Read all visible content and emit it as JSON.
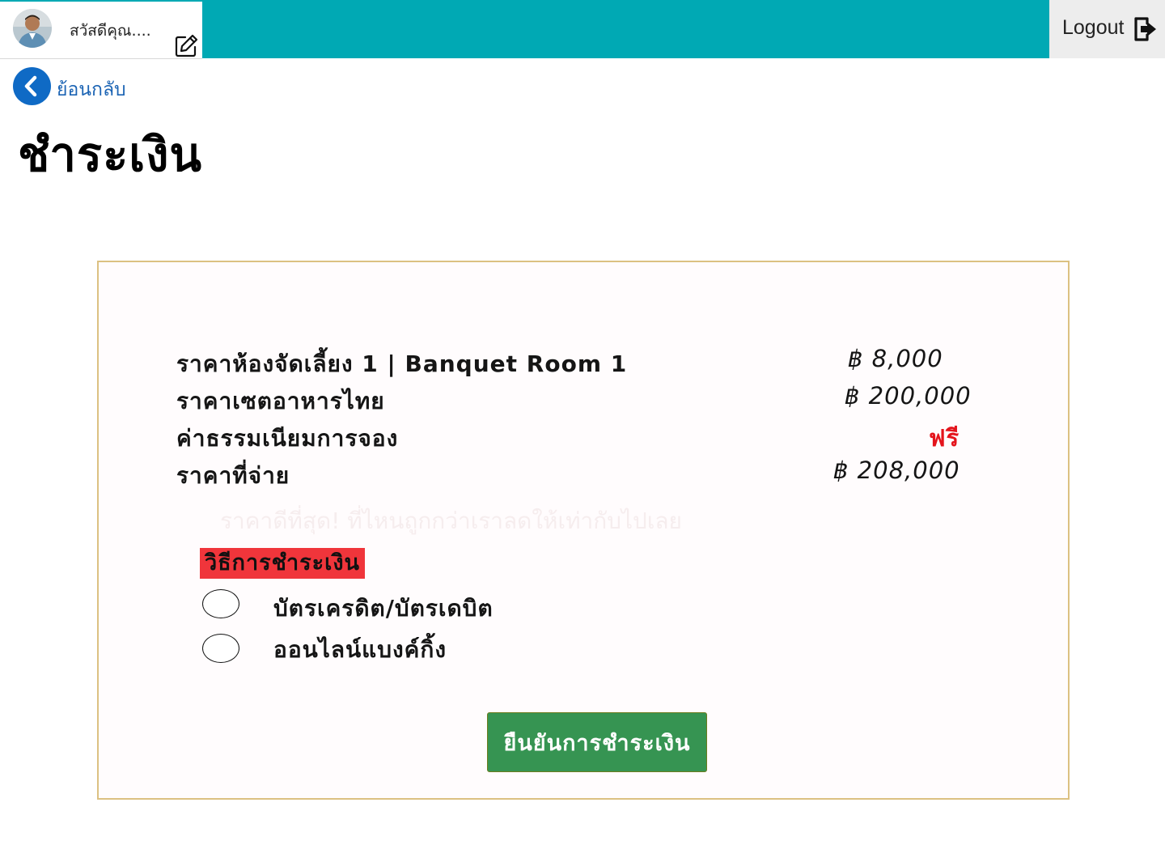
{
  "header": {
    "greeting": "สวัสดีคุณ....",
    "logout_label": "Logout",
    "accent_color": "#00a9b4",
    "icons": {
      "avatar": "user-photo",
      "edit": "edit-icon",
      "logout": "logout-icon"
    }
  },
  "nav": {
    "back_label": "ย้อนกลับ",
    "back_icon": "chevron-left-icon"
  },
  "page": {
    "title": "ชำระเงิน"
  },
  "summary": {
    "rows": [
      {
        "label": "ราคาห้องจัดเลี้ยง 1 | Banquet Room 1",
        "value": "฿  8,000"
      },
      {
        "label": "ราคาเซตอาหารไทย",
        "value": "฿ 200,000"
      },
      {
        "label": "ค่าธรรมเนียมการจอง",
        "value": "ฟรี"
      },
      {
        "label": "ราคาที่จ่าย",
        "value": "฿ 208,000"
      }
    ],
    "promo_text": "ราคาดีที่สุด! ที่ไหนถูกกว่าเราลดให้เท่ากับไปเลย"
  },
  "payment": {
    "heading": "วิธีการชำระเงิน",
    "options": [
      {
        "label": "บัตรเครดิต/บัตรเดบิต"
      },
      {
        "label": "ออนไลน์แบงค์กิ้ง"
      }
    ],
    "confirm_label": "ยืนยันการชำระเงิน",
    "heading_color": "#f0353b",
    "confirm_color": "#369452"
  }
}
